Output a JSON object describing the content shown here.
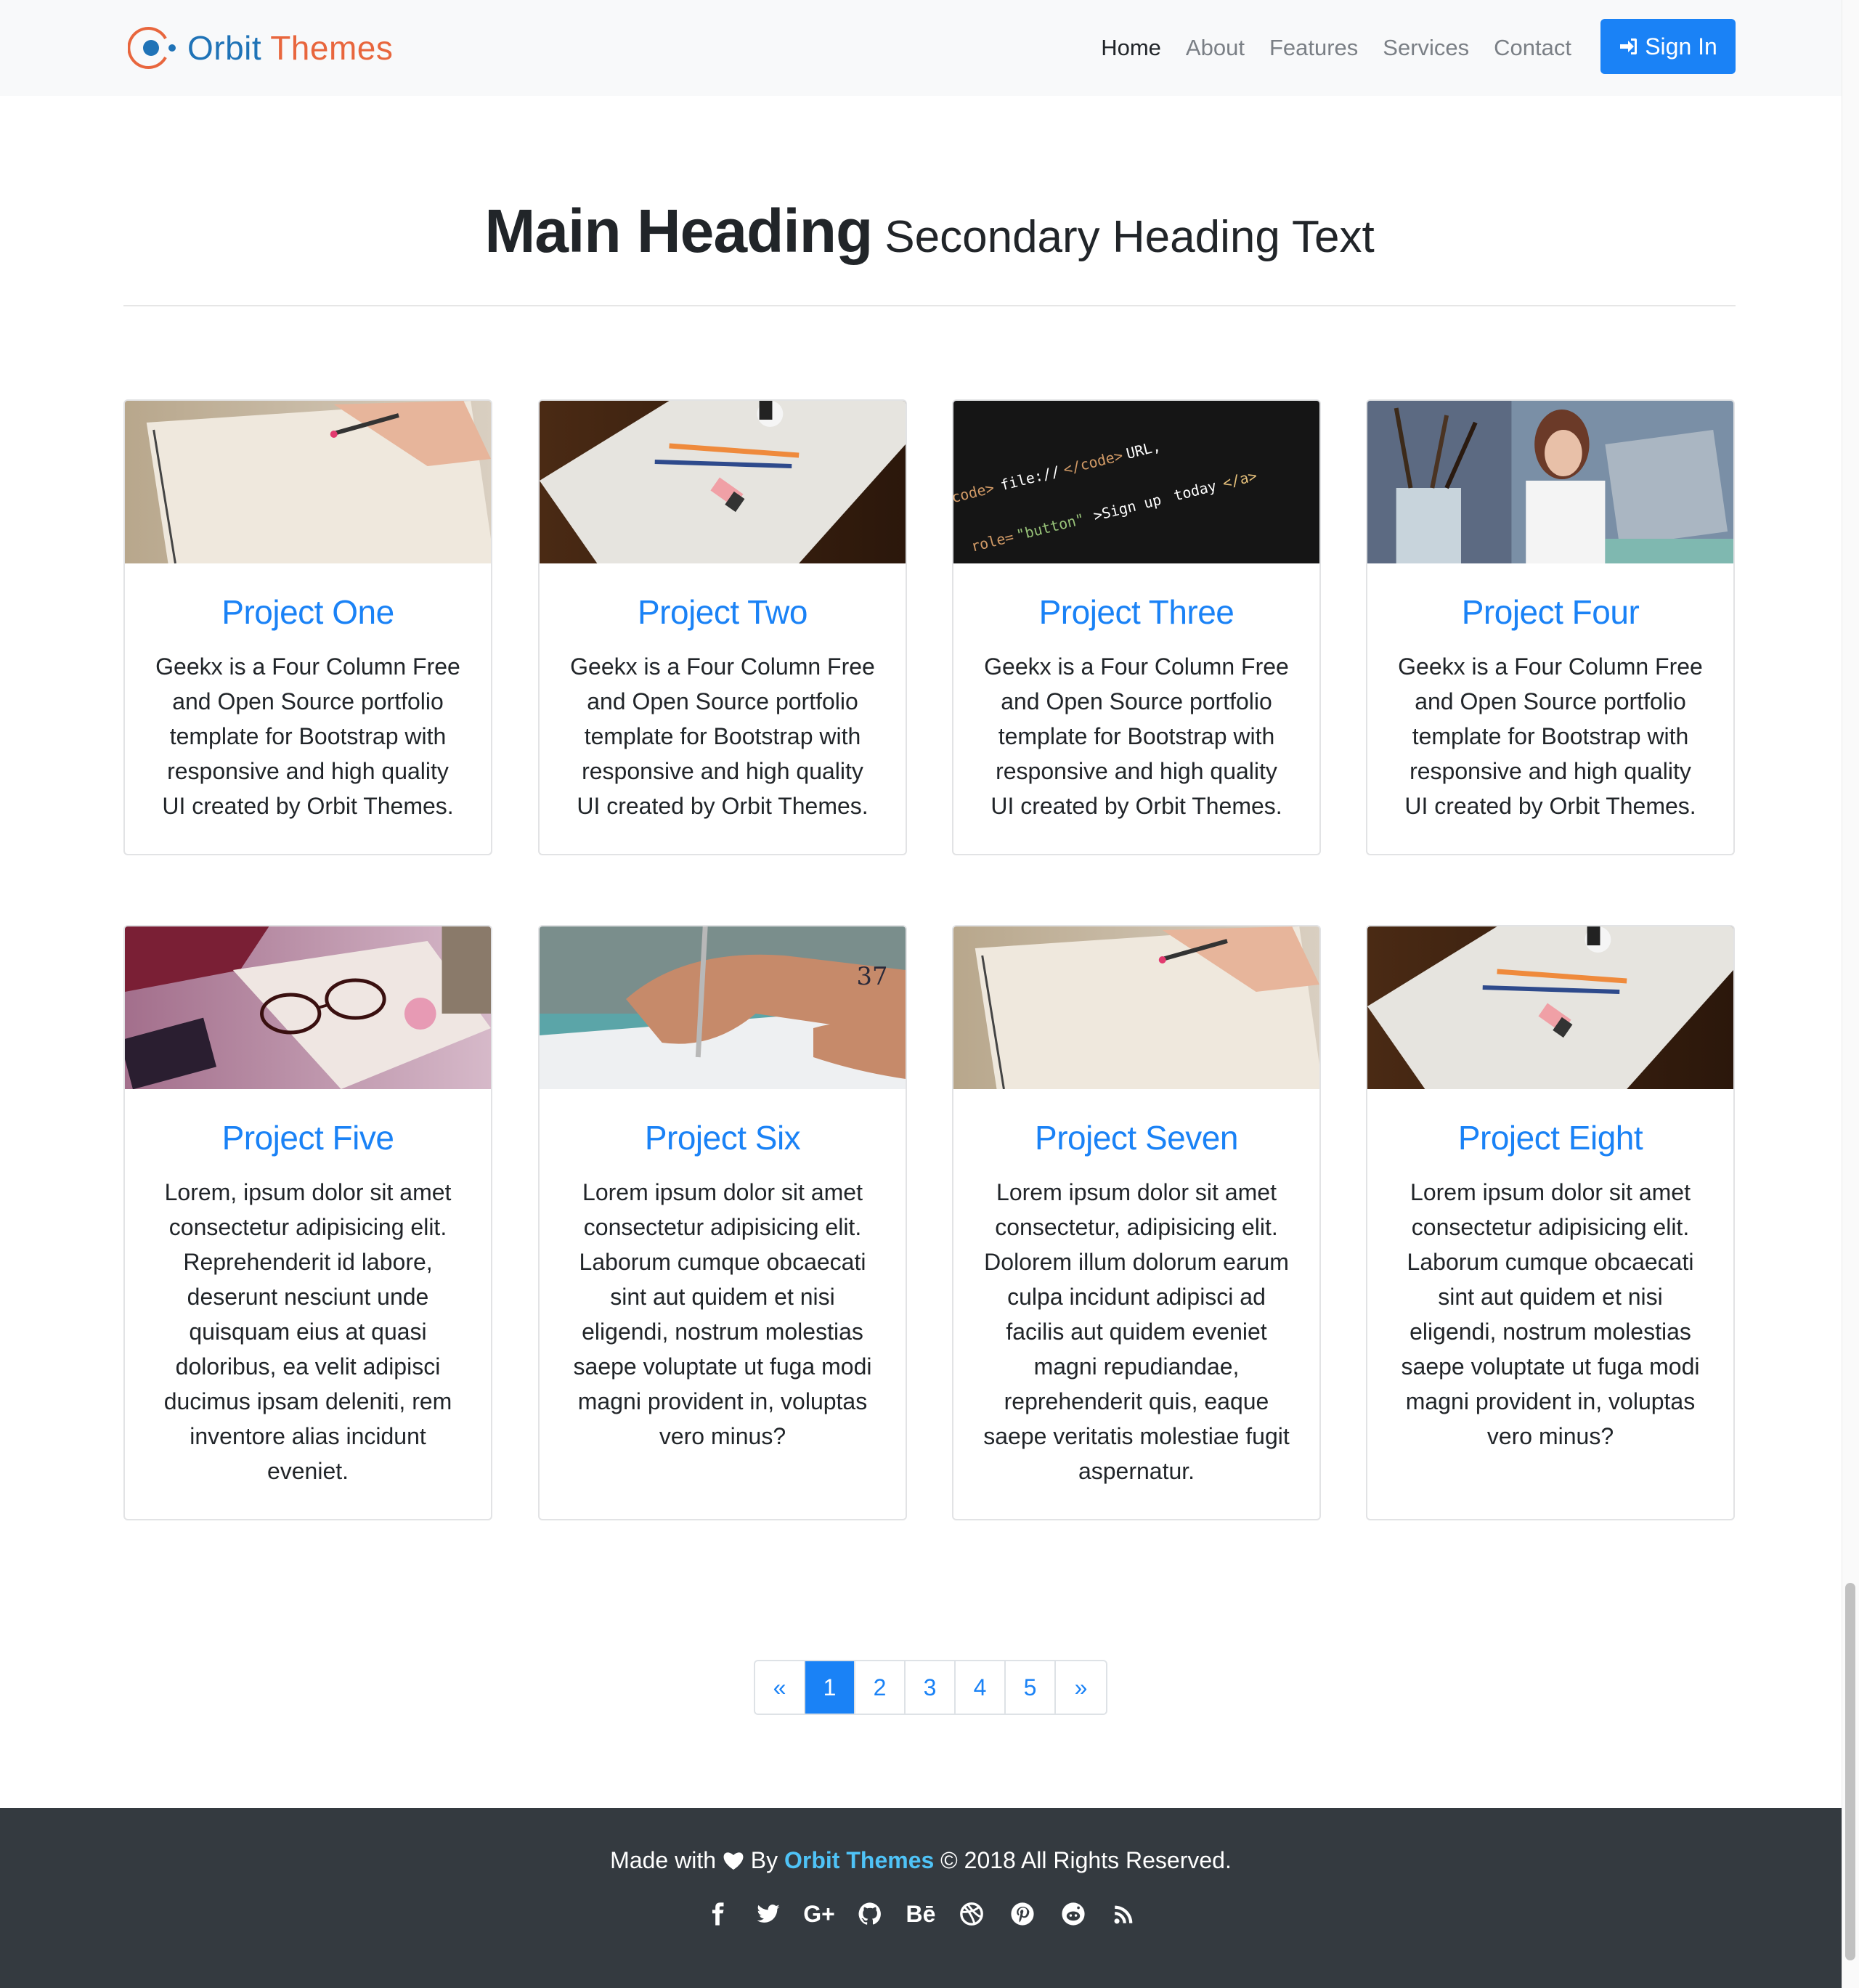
{
  "navbar": {
    "brand_word1": "Orbit",
    "brand_word2": "Themes",
    "links": [
      "Home",
      "About",
      "Features",
      "Services",
      "Contact"
    ],
    "active_link": "Home",
    "signin_label": "Sign In"
  },
  "heading": {
    "main": "Main Heading",
    "secondary": "Secondary Heading Text"
  },
  "projects": [
    {
      "title": "Project One",
      "text": "Geekx is a Four Column Free and Open Source portfolio template for Bootstrap with responsive and high quality UI created by Orbit Themes.",
      "image": "notebook-writing"
    },
    {
      "title": "Project Two",
      "text": "Geekx is a Four Column Free and Open Source portfolio template for Bootstrap with responsive and high quality UI created by Orbit Themes.",
      "image": "paper-pencils"
    },
    {
      "title": "Project Three",
      "text": "Geekx is a Four Column Free and Open Source portfolio template for Bootstrap with responsive and high quality UI created by Orbit Themes.",
      "image": "code-screen"
    },
    {
      "title": "Project Four",
      "text": "Geekx is a Four Column Free and Open Source portfolio template for Bootstrap with responsive and high quality UI created by Orbit Themes.",
      "image": "woman-laptop"
    },
    {
      "title": "Project Five",
      "text": "Lorem, ipsum dolor sit amet consectetur adipisicing elit. Reprehenderit id labore, deserunt nesciunt unde quisquam eius at quasi doloribus, ea velit adipisci ducimus ipsam deleniti, rem inventore alias incidunt eveniet.",
      "image": "glasses-desk"
    },
    {
      "title": "Project Six",
      "text": "Lorem ipsum dolor sit amet consectetur adipisicing elit. Laborum cumque obcaecati sint aut quidem et nisi eligendi, nostrum molestias saepe voluptate ut fuga modi magni provident in, voluptas vero minus?",
      "image": "hand-writing"
    },
    {
      "title": "Project Seven",
      "text": "Lorem ipsum dolor sit amet consectetur, adipisicing elit. Dolorem illum dolorum earum culpa incidunt adipisci ad facilis aut quidem eveniet magni repudiandae, reprehenderit quis, eaque saepe veritatis molestiae fugit aspernatur.",
      "image": "notebook-writing"
    },
    {
      "title": "Project Eight",
      "text": "Lorem ipsum dolor sit amet consectetur adipisicing elit. Laborum cumque obcaecati sint aut quidem et nisi eligendi, nostrum molestias saepe voluptate ut fuga modi magni provident in, voluptas vero minus?",
      "image": "paper-pencils"
    }
  ],
  "pagination": {
    "prev": "«",
    "pages": [
      "1",
      "2",
      "3",
      "4",
      "5"
    ],
    "current": "1",
    "next": "»"
  },
  "footer": {
    "made_with": "Made with",
    "by": "By",
    "brand": "Orbit Themes",
    "rights": "© 2018 All Rights Reserved.",
    "social_icons": [
      "facebook-icon",
      "twitter-icon",
      "google-plus-icon",
      "github-icon",
      "behance-icon",
      "dribbble-icon",
      "pinterest-icon",
      "reddit-icon",
      "rss-icon"
    ],
    "google_plus_label": "G+",
    "behance_label": "Bē"
  },
  "colors": {
    "primary": "#1a82f6",
    "brand_blue": "#1f73b7",
    "brand_orange": "#e8663d",
    "footer_bg": "#343a40",
    "footer_link": "#4fc3f7"
  }
}
